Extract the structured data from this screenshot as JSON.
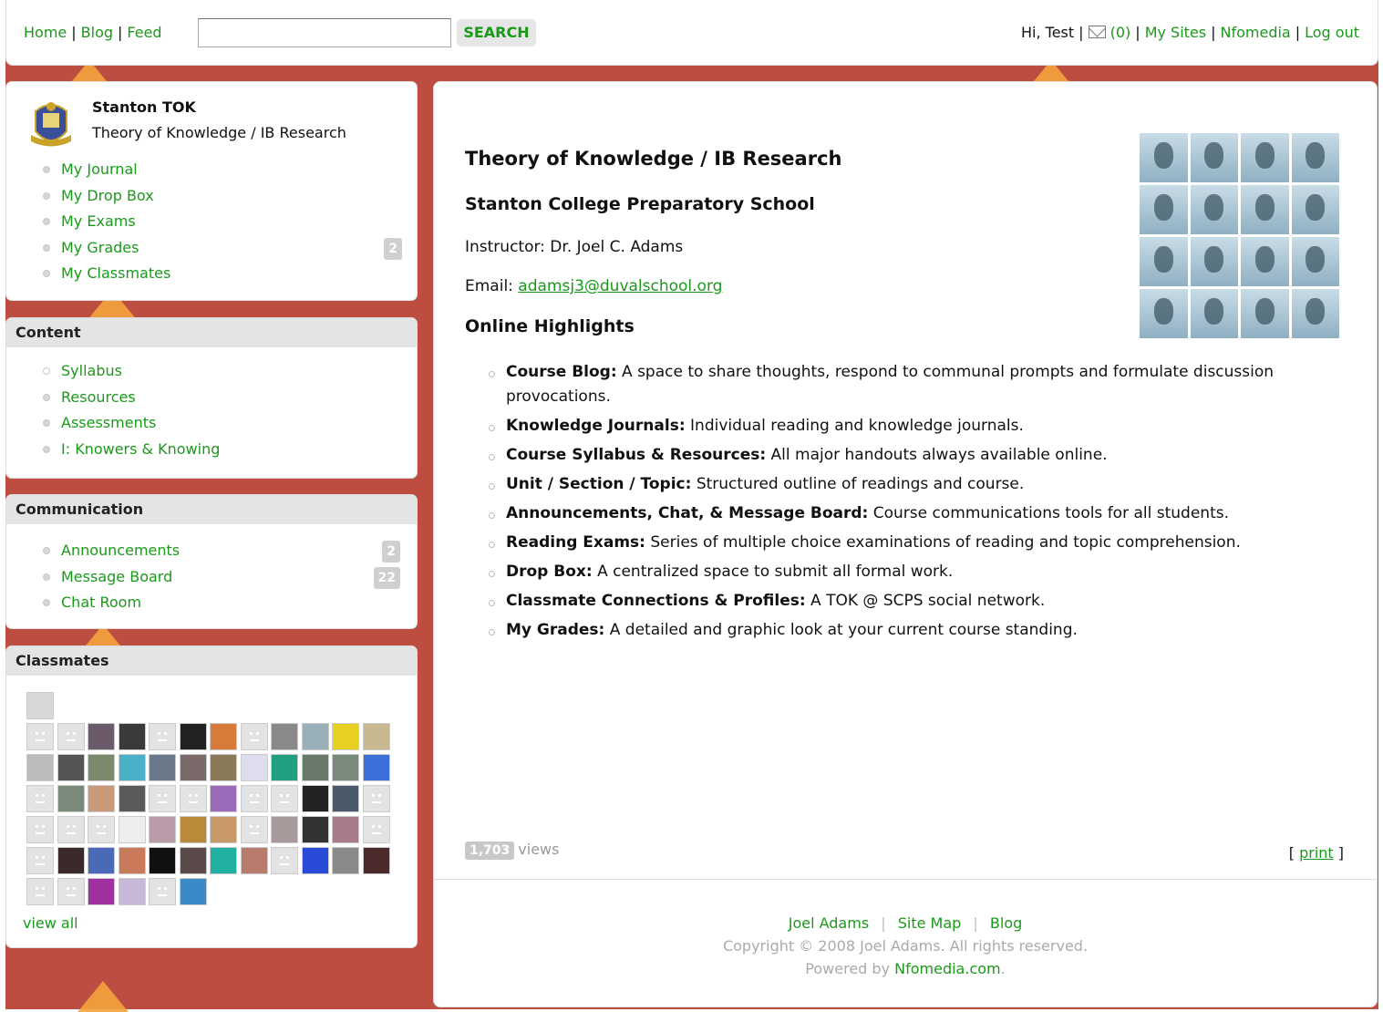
{
  "topbar": {
    "nav": [
      "Home",
      "Blog",
      "Feed"
    ],
    "search_placeholder": "",
    "search_label": "SEARCH",
    "greeting": "Hi, Test",
    "mail_count": "(0)",
    "links": [
      "My Sites",
      "Nfomedia",
      "Log out"
    ]
  },
  "profile": {
    "name": "Stanton TOK",
    "subtitle": "Theory of Knowledge / IB Research",
    "items": [
      {
        "label": "My Journal"
      },
      {
        "label": "My Drop Box"
      },
      {
        "label": "My Exams"
      },
      {
        "label": "My Grades",
        "badge": "2"
      },
      {
        "label": "My Classmates"
      }
    ]
  },
  "content": {
    "title": "Content",
    "items": [
      "Syllabus",
      "Resources",
      "Assessments",
      "I: Knowers & Knowing"
    ]
  },
  "communication": {
    "title": "Communication",
    "items": [
      {
        "label": "Announcements",
        "badge": "2"
      },
      {
        "label": "Message Board",
        "badge": "22"
      },
      {
        "label": "Chat Room"
      }
    ]
  },
  "classmates": {
    "title": "Classmates",
    "view_all": "view all"
  },
  "main": {
    "title": "Theory of Knowledge / IB Research",
    "school": "Stanton College Preparatory School",
    "instructor": "Instructor: Dr. Joel C. Adams",
    "email_label": "Email: ",
    "email": "adamsj3@duvalschool.org",
    "highlights_title": "Online Highlights",
    "highlights": [
      {
        "bold": "Course Blog:",
        "text": " A space to share thoughts, respond to communal prompts and formulate discussion provocations."
      },
      {
        "bold": "Knowledge Journals:",
        "text": " Individual reading and knowledge journals."
      },
      {
        "bold": "Course Syllabus & Resources:",
        "text": " All major handouts always available online."
      },
      {
        "bold": "Unit / Section / Topic:",
        "text": " Structured outline of readings and course."
      },
      {
        "bold": "Announcements, Chat, & Message Board:",
        "text": " Course communications tools for all students."
      },
      {
        "bold": "Reading Exams:",
        "text": " Series of multiple choice examinations of reading and topic comprehension."
      },
      {
        "bold": "Drop Box:",
        "text": " A centralized space to submit all formal work."
      },
      {
        "bold": "Classmate Connections & Profiles:",
        "text": " A TOK @ SCPS social network."
      },
      {
        "bold": "My Grades:",
        "text": " A detailed and graphic look at your current course standing."
      }
    ],
    "views_count": "1,703",
    "views_label": "views",
    "print_open": "[ ",
    "print_label": "print",
    "print_close": " ]"
  },
  "footer": {
    "links": [
      "Joel Adams",
      "Site Map",
      "Blog"
    ],
    "copyright": "Copyright © 2008 Joel Adams. All rights reserved.",
    "powered_prefix": "Powered by ",
    "powered_link": "Nfomedia.com",
    "powered_suffix": "."
  }
}
